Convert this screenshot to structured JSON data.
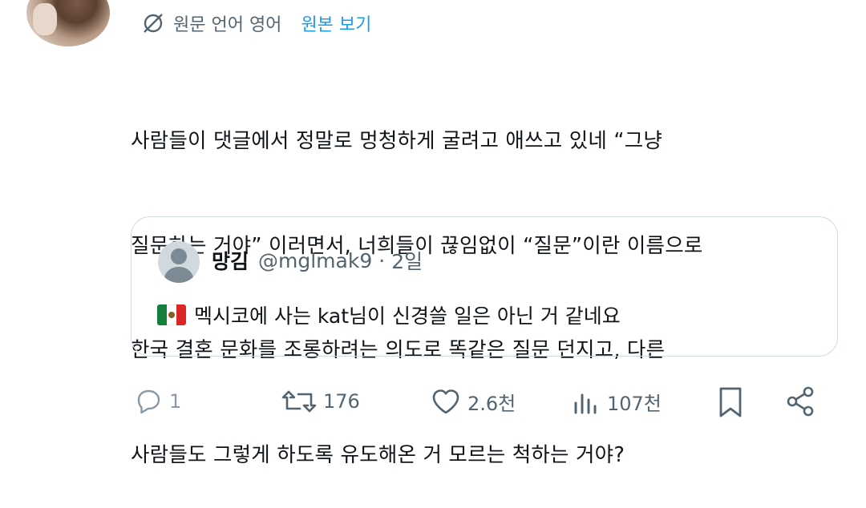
{
  "translation": {
    "label": "원문 언어 영어",
    "view_original": "원본 보기"
  },
  "tweet": {
    "lines": [
      "사람들이 댓글에서 정말로 멍청하게 굴려고 애쓰고 있네 “그냥",
      "질문하는 거야” 이러면서, 너희들이 끊임없이 “질문”이란 이름으로",
      "한국 결혼 문화를 조롱하려는 의도로 똑같은 질문 던지고, 다른",
      "사람들도 그렇게 하도록 유도해온 거 모르는 척하는 거야?"
    ]
  },
  "quote": {
    "name": "망김",
    "handle": "@mglmak9",
    "dot": "·",
    "time": "2일",
    "text": "멕시코에 사는 kat님이 신경쓸 일은 아닌 거 같네요",
    "flag": "mexico-flag"
  },
  "actions": {
    "reply_count": "1",
    "retweet_count": "176",
    "like_count": "2.6천",
    "view_count": "107천"
  },
  "colors": {
    "text": "#0f1419",
    "secondary": "#536471",
    "link": "#1d9bf0",
    "border": "#cfd9de"
  }
}
